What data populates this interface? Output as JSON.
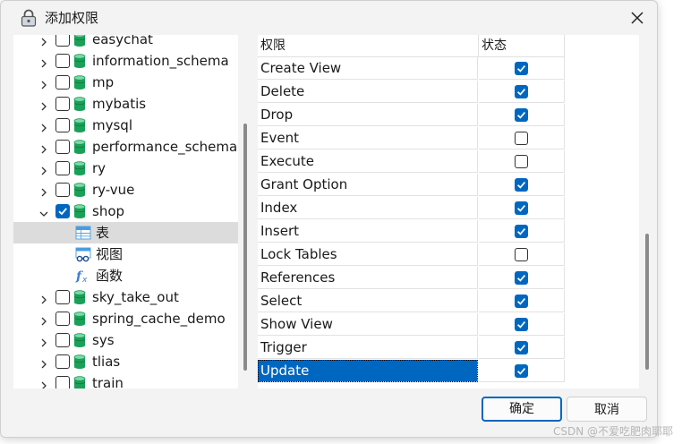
{
  "window": {
    "title": "添加权限"
  },
  "tree": {
    "items": [
      {
        "label": "easychat",
        "checked": false,
        "expanded": false
      },
      {
        "label": "information_schema",
        "checked": false,
        "expanded": false
      },
      {
        "label": "mp",
        "checked": false,
        "expanded": false
      },
      {
        "label": "mybatis",
        "checked": false,
        "expanded": false
      },
      {
        "label": "mysql",
        "checked": false,
        "expanded": false
      },
      {
        "label": "performance_schema",
        "checked": false,
        "expanded": false
      },
      {
        "label": "ry",
        "checked": false,
        "expanded": false
      },
      {
        "label": "ry-vue",
        "checked": false,
        "expanded": false
      },
      {
        "label": "shop",
        "checked": true,
        "expanded": true
      },
      {
        "label": "sky_take_out",
        "checked": false,
        "expanded": false
      },
      {
        "label": "spring_cache_demo",
        "checked": false,
        "expanded": false
      },
      {
        "label": "sys",
        "checked": false,
        "expanded": false
      },
      {
        "label": "tlias",
        "checked": false,
        "expanded": false
      },
      {
        "label": "train",
        "checked": false,
        "expanded": false
      }
    ],
    "shop_children": [
      {
        "label": "表",
        "icon": "table-icon",
        "selected": true
      },
      {
        "label": "视图",
        "icon": "view-icon",
        "selected": false
      },
      {
        "label": "函数",
        "icon": "function-icon",
        "selected": false
      }
    ]
  },
  "table": {
    "headers": {
      "privilege": "权限",
      "status": "状态"
    },
    "rows": [
      {
        "name": "Create View",
        "checked": true
      },
      {
        "name": "Delete",
        "checked": true
      },
      {
        "name": "Drop",
        "checked": true
      },
      {
        "name": "Event",
        "checked": false
      },
      {
        "name": "Execute",
        "checked": false
      },
      {
        "name": "Grant Option",
        "checked": true
      },
      {
        "name": "Index",
        "checked": true
      },
      {
        "name": "Insert",
        "checked": true
      },
      {
        "name": "Lock Tables",
        "checked": false
      },
      {
        "name": "References",
        "checked": true
      },
      {
        "name": "Select",
        "checked": true
      },
      {
        "name": "Show View",
        "checked": true
      },
      {
        "name": "Trigger",
        "checked": true
      },
      {
        "name": "Update",
        "checked": true
      }
    ],
    "selected_row": "Update"
  },
  "buttons": {
    "ok": "确定",
    "cancel": "取消"
  },
  "watermark": "CSDN @不爱吃肥肉耶耶",
  "colors": {
    "accent": "#0067c0",
    "db_icon": "#1aa058",
    "selection": "#0067c0"
  }
}
